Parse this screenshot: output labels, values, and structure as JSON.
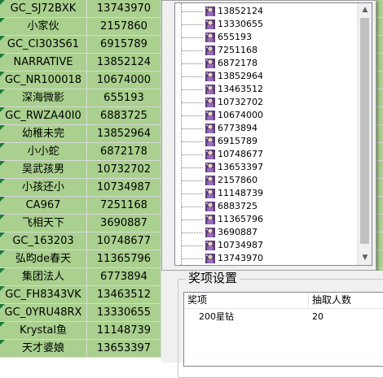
{
  "sheet_rows": [
    {
      "name": "GC_SJ72BXK",
      "id": "13743970"
    },
    {
      "name": "小家伙",
      "id": "2157860"
    },
    {
      "name": "GC_CI303S61",
      "id": "6915789"
    },
    {
      "name": "NARRATIVE",
      "id": "13852124"
    },
    {
      "name": "GC_NR100018",
      "id": "10674000"
    },
    {
      "name": "深海微影",
      "id": "655193"
    },
    {
      "name": "GC_RWZA40I0",
      "id": "6883725"
    },
    {
      "name": "幼稚未完",
      "id": "13852964"
    },
    {
      "name": "小小蛇",
      "id": "6872178"
    },
    {
      "name": "吴武孩男",
      "id": "10732702"
    },
    {
      "name": "小孩还小",
      "id": "10734987"
    },
    {
      "name": "CA967",
      "id": "7251168"
    },
    {
      "name": "飞相天下",
      "id": "3690887"
    },
    {
      "name": "GC_163203",
      "id": "10748677"
    },
    {
      "name": "弘昀de春天",
      "id": "11365796"
    },
    {
      "name": "集团法人",
      "id": "6773894"
    },
    {
      "name": "GC_FH8343VK",
      "id": "13463512"
    },
    {
      "name": "GC_0YRU48RX",
      "id": "13330655"
    },
    {
      "name": "Krystal鱼",
      "id": "11148739"
    },
    {
      "name": "天才婆娘",
      "id": "13653397"
    }
  ],
  "list_items": [
    "13852124",
    "13330655",
    "655193",
    "7251168",
    "6872178",
    "13852964",
    "13463512",
    "10732702",
    "10674000",
    "6773894",
    "6915789",
    "10748677",
    "13653397",
    "2157860",
    "11148739",
    "6883725",
    "11365796",
    "3690887",
    "10734987",
    "13743970"
  ],
  "list_icon": "person-icon",
  "prize_panel": {
    "title": "奖项设置",
    "columns": [
      "奖项",
      "抽取人数"
    ],
    "rows": [
      {
        "prize": "200星钻",
        "count": "20"
      }
    ]
  }
}
